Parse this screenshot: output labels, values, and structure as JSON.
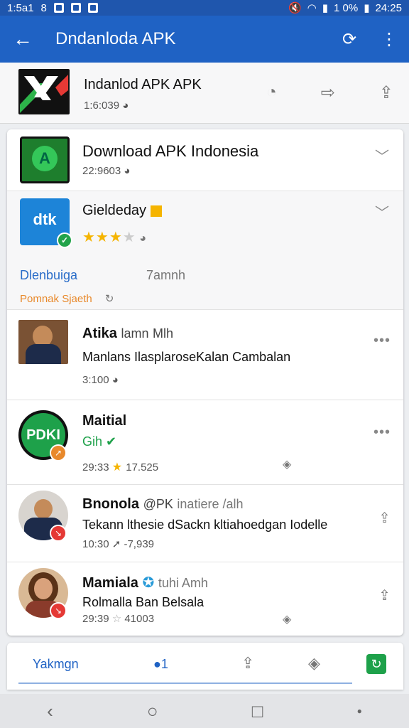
{
  "status": {
    "left_time": "1:5a1",
    "left_num": "8",
    "right_level": "1 0%",
    "right_time": "24:25"
  },
  "appbar": {
    "title": "Dndanloda APK"
  },
  "top": {
    "title": "Indanlod APK APK",
    "meta": "1:6:039"
  },
  "rows": [
    {
      "title": "Download APK Indonesia",
      "meta": "22:9603"
    },
    {
      "title": "Gieldeday",
      "link1": "Dlenbuiga",
      "link2": "7amnh",
      "orange": "Pomnak Sjaeth",
      "rating": 3
    },
    {
      "name": "Atika",
      "name_green": "lamn",
      "name_sub": "Mlh",
      "text": "Manlans IlasplaroseKalan Cambalan",
      "meta": "3:100"
    },
    {
      "name": "Maitial",
      "name_green": "Gih",
      "meta": "29:33",
      "meta2": "17.525",
      "icon_text": "PDKI"
    },
    {
      "name": "Bnonola",
      "name_green": "@PK",
      "name_sub": "inatiere /alh",
      "text": "Tekann lthesie dSackn kltiahoedgan Iodelle",
      "meta": "10:30",
      "meta2": "-7,939"
    },
    {
      "name": "Mamiala",
      "name_sub": "tuhi Amh",
      "text": "Rolmalla Ban Belsala",
      "meta": "29:39",
      "meta2": "41003"
    }
  ],
  "bottom": {
    "tab1": "Yakmgn",
    "tab2_count": "1"
  },
  "colors": {
    "primary": "#1f62c4",
    "green": "#1ea14a",
    "orange": "#e8892b",
    "star": "#f5b400"
  }
}
